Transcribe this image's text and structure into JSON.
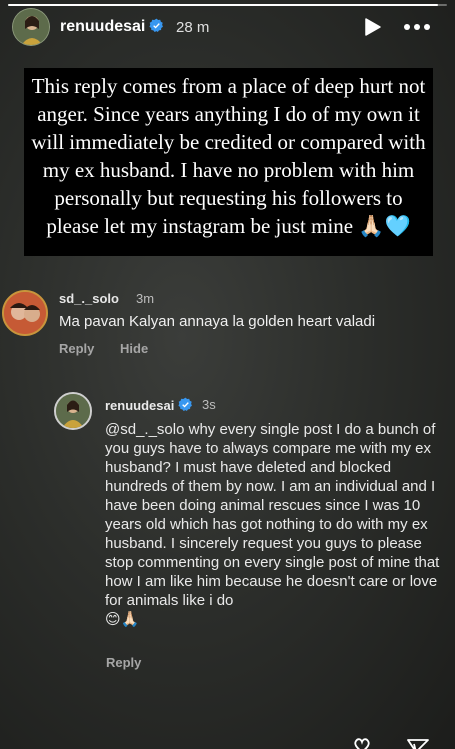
{
  "story": {
    "progress": 0.98,
    "username": "renuudesai",
    "time": "28 m",
    "caption": "This reply comes from a place of deep hurt not anger. Since years anything I do of my own it will immediately be credited or compared with my ex husband. I have no problem with him personally but requesting his followers to please let my instagram be just mine",
    "caption_emoji": "🙏🏻🩵"
  },
  "comment": {
    "username": "sd_._solo",
    "time": "3m",
    "text": "Ma pavan Kalyan annaya la golden heart valadi",
    "reply_label": "Reply",
    "hide_label": "Hide"
  },
  "reply": {
    "username": "renuudesai",
    "time": "3s",
    "text": "@sd_._solo why every single post I do a bunch of you guys have to always compare me with my ex husband? I must have deleted and blocked hundreds of them by now. I am an individual and I have been doing animal rescues since I was 10 years old which has got nothing to do with my ex husband. I sincerely request you guys to please stop commenting on every single post of mine that how I am like him because he doesn't care or love for animals like i do",
    "emoji": "😊🙏🏻",
    "reply_label": "Reply"
  },
  "colors": {
    "verified_blue": "#3897f0",
    "muted_text": "#a6a6a6"
  },
  "icons": [
    "verified-icon",
    "play-icon",
    "more-icon",
    "heart-icon",
    "send-icon"
  ]
}
